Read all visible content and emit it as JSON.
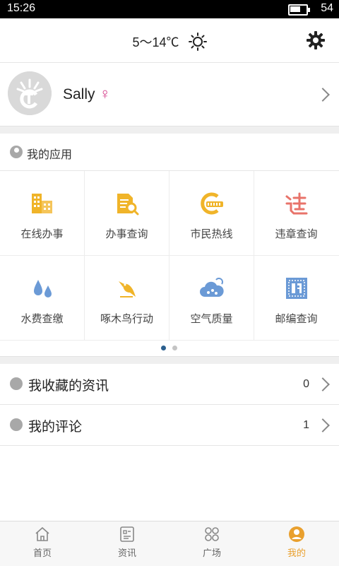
{
  "status_bar": {
    "time": "15:26",
    "battery_level": "54"
  },
  "header": {
    "weather": "5～14℃",
    "weather_icon": "sun-icon",
    "settings_icon": "gear-icon"
  },
  "profile": {
    "name": "Sally",
    "gender_symbol": "♀"
  },
  "apps": {
    "title": "我的应用",
    "items": [
      {
        "label": "在线办事",
        "icon": "building-icon",
        "color": "#f0b429"
      },
      {
        "label": "办事查询",
        "icon": "document-search-icon",
        "color": "#f0b429"
      },
      {
        "label": "市民热线",
        "icon": "hotline-12345-icon",
        "color": "#f0b429"
      },
      {
        "label": "违章查询",
        "icon": "violation-icon",
        "color": "#e8736a"
      },
      {
        "label": "水费查缴",
        "icon": "water-drops-icon",
        "color": "#6b9ad6"
      },
      {
        "label": "啄木鸟行动",
        "icon": "woodpecker-icon",
        "color": "#f0b429"
      },
      {
        "label": "空气质量",
        "icon": "cloud-icon",
        "color": "#6b9ad6"
      },
      {
        "label": "邮编查询",
        "icon": "postal-stamp-icon",
        "color": "#6b9ad6"
      }
    ],
    "page_indicator": {
      "current": 1,
      "total": 2
    }
  },
  "lists": [
    {
      "label": "我收藏的资讯",
      "count": "0"
    },
    {
      "label": "我的评论",
      "count": "1"
    }
  ],
  "tabs": [
    {
      "label": "首页",
      "icon": "home-icon"
    },
    {
      "label": "资讯",
      "icon": "news-icon"
    },
    {
      "label": "广场",
      "icon": "square-grid-icon"
    },
    {
      "label": "我的",
      "icon": "user-icon",
      "active": true
    }
  ],
  "colors": {
    "accent": "#e9a02e",
    "dot_active": "#2b5f8e",
    "dot_inactive": "#c4c4c4"
  }
}
